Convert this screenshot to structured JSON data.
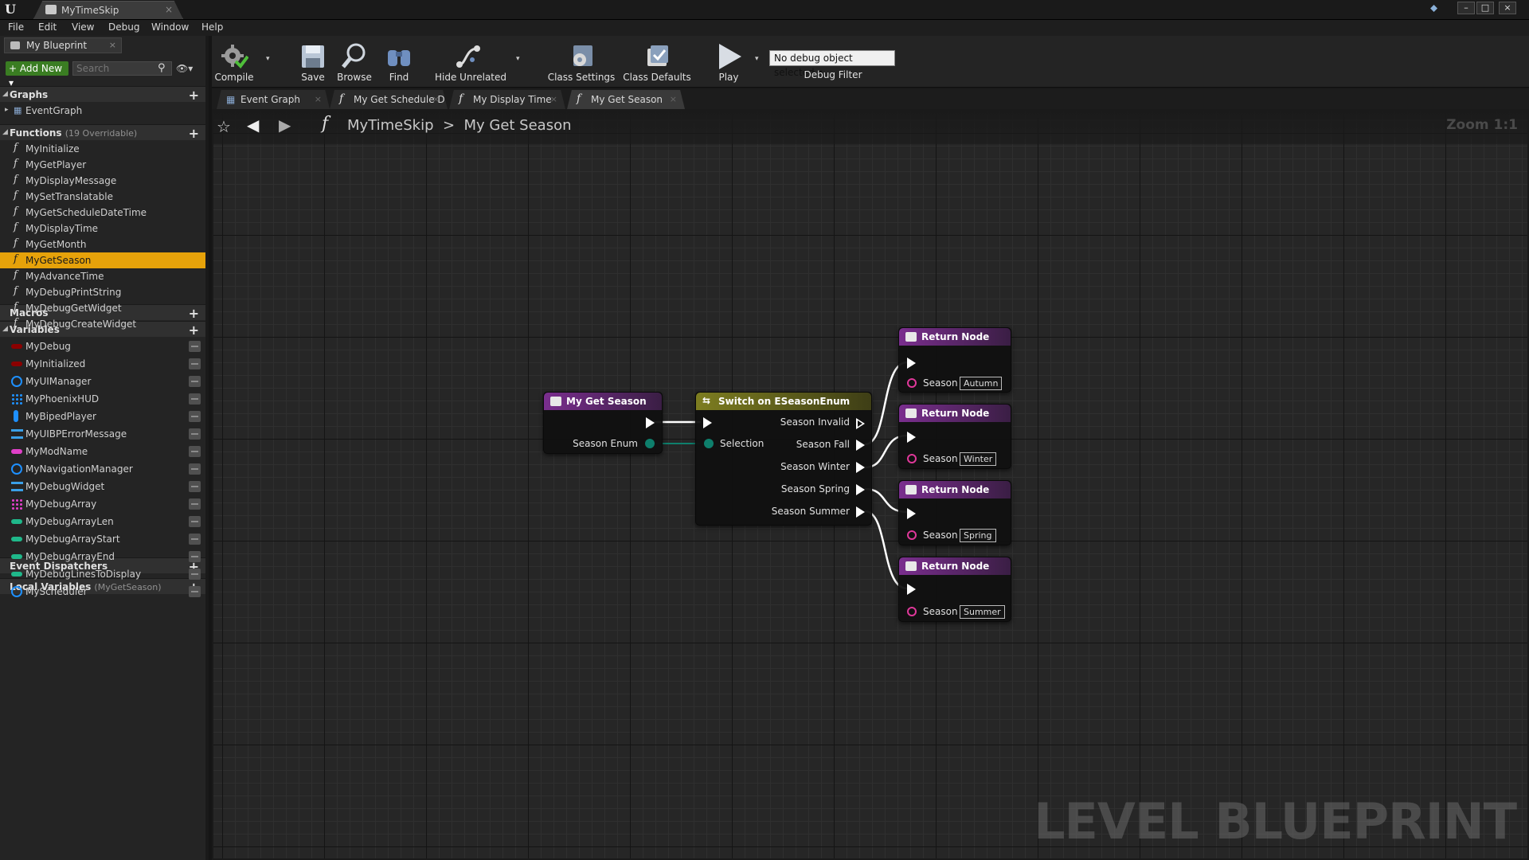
{
  "window": {
    "tab_title": "MyTimeSkip",
    "tab_close": "×",
    "minimize": "–",
    "maximize": "□",
    "close": "×"
  },
  "menu": [
    "File",
    "Edit",
    "View",
    "Debug",
    "Window",
    "Help"
  ],
  "left_panel": {
    "tab_label": "My Blueprint",
    "tab_close": "×",
    "add_new_label": "+ Add New ▾",
    "search_placeholder": "Search",
    "search_icon_glyph": "⚲",
    "eye_glyph": "👁▾",
    "sections": {
      "graphs": {
        "label": "Graphs",
        "items": [
          "EventGraph"
        ]
      },
      "functions": {
        "label": "Functions",
        "sub": "(19 Overridable)",
        "items": [
          "MyInitialize",
          "MyGetPlayer",
          "MyDisplayMessage",
          "MySetTranslatable",
          "MyGetScheduleDateTime",
          "MyDisplayTime",
          "MyGetMonth",
          "MyGetSeason",
          "MyAdvanceTime",
          "MyDebugPrintString",
          "MyDebugGetWidget",
          "MyDebugCreateWidget"
        ],
        "selected": "MyGetSeason"
      },
      "macros": {
        "label": "Macros"
      },
      "variables": {
        "label": "Variables",
        "items": [
          {
            "name": "MyDebug",
            "color": "#8b0000",
            "type": "pill"
          },
          {
            "name": "MyInitialized",
            "color": "#8b0000",
            "type": "pill"
          },
          {
            "name": "MyUIManager",
            "color": "#1e90ff",
            "type": "ring"
          },
          {
            "name": "MyPhoenixHUD",
            "color": "#1e90ff",
            "type": "grid"
          },
          {
            "name": "MyBipedPlayer",
            "color": "#1e90ff",
            "type": "person"
          },
          {
            "name": "MyUIBPErrorMessage",
            "color": "#3aa0e8",
            "type": "stack"
          },
          {
            "name": "MyModName",
            "color": "#e040c8",
            "type": "pill"
          },
          {
            "name": "MyNavigationManager",
            "color": "#1e90ff",
            "type": "ring"
          },
          {
            "name": "MyDebugWidget",
            "color": "#3aa0e8",
            "type": "stack"
          },
          {
            "name": "MyDebugArray",
            "color": "#e040c8",
            "type": "grid"
          },
          {
            "name": "MyDebugArrayLen",
            "color": "#1fb88a",
            "type": "pill"
          },
          {
            "name": "MyDebugArrayStart",
            "color": "#1fb88a",
            "type": "pill"
          },
          {
            "name": "MyDebugArrayEnd",
            "color": "#1fb88a",
            "type": "pill"
          },
          {
            "name": "MyDebugLinesToDisplay",
            "color": "#1fb88a",
            "type": "pill"
          },
          {
            "name": "MyScheduler",
            "color": "#1e90ff",
            "type": "ring"
          }
        ]
      },
      "event_dispatchers": {
        "label": "Event Dispatchers"
      },
      "local_variables": {
        "label": "Local Variables",
        "sub": "(MyGetSeason)"
      }
    }
  },
  "toolbar": {
    "buttons": [
      "Compile",
      "Save",
      "Browse",
      "Find",
      "Hide Unrelated",
      "Class Settings",
      "Class Defaults",
      "Play"
    ],
    "dropdown_glyph": "▾",
    "debug_select": "No debug object selected ▾",
    "debug_filter": "Debug Filter"
  },
  "graph_tabs": [
    {
      "label": "Event Graph",
      "icon": "grid"
    },
    {
      "label": "My Get Schedule D",
      "icon": "fn"
    },
    {
      "label": "My Display Time",
      "icon": "fn"
    },
    {
      "label": "My Get Season",
      "icon": "fn"
    }
  ],
  "graph_tab_close": "×",
  "graph": {
    "breadcrumb": "MyTimeSkip  >  My Get Season",
    "zoom": "Zoom 1:1",
    "watermark": "LEVEL BLUEPRINT",
    "nav_glyphs": {
      "fav": "☆",
      "back": "◀",
      "forward": "▶",
      "fn": "f"
    },
    "nodes": {
      "entry": {
        "title": "My Get Season",
        "output_label": "Season Enum"
      },
      "switch": {
        "title": "Switch on ESeasonEnum",
        "icon_glyph": "⇆",
        "input_label": "Selection",
        "outputs": [
          "Season Invalid",
          "Season Fall",
          "Season Winter",
          "Season Spring",
          "Season Summer"
        ]
      },
      "returns": [
        {
          "title": "Return Node",
          "pin_label": "Season",
          "value": "Autumn"
        },
        {
          "title": "Return Node",
          "pin_label": "Season",
          "value": "Winter"
        },
        {
          "title": "Return Node",
          "pin_label": "Season",
          "value": "Spring"
        },
        {
          "title": "Return Node",
          "pin_label": "Season",
          "value": "Summer"
        }
      ]
    }
  },
  "colors": {
    "selected": "#e6a20a",
    "enum_pin": "#0e7f6c",
    "return_pin": "#e0389a",
    "add_new": "#3a7d22"
  }
}
